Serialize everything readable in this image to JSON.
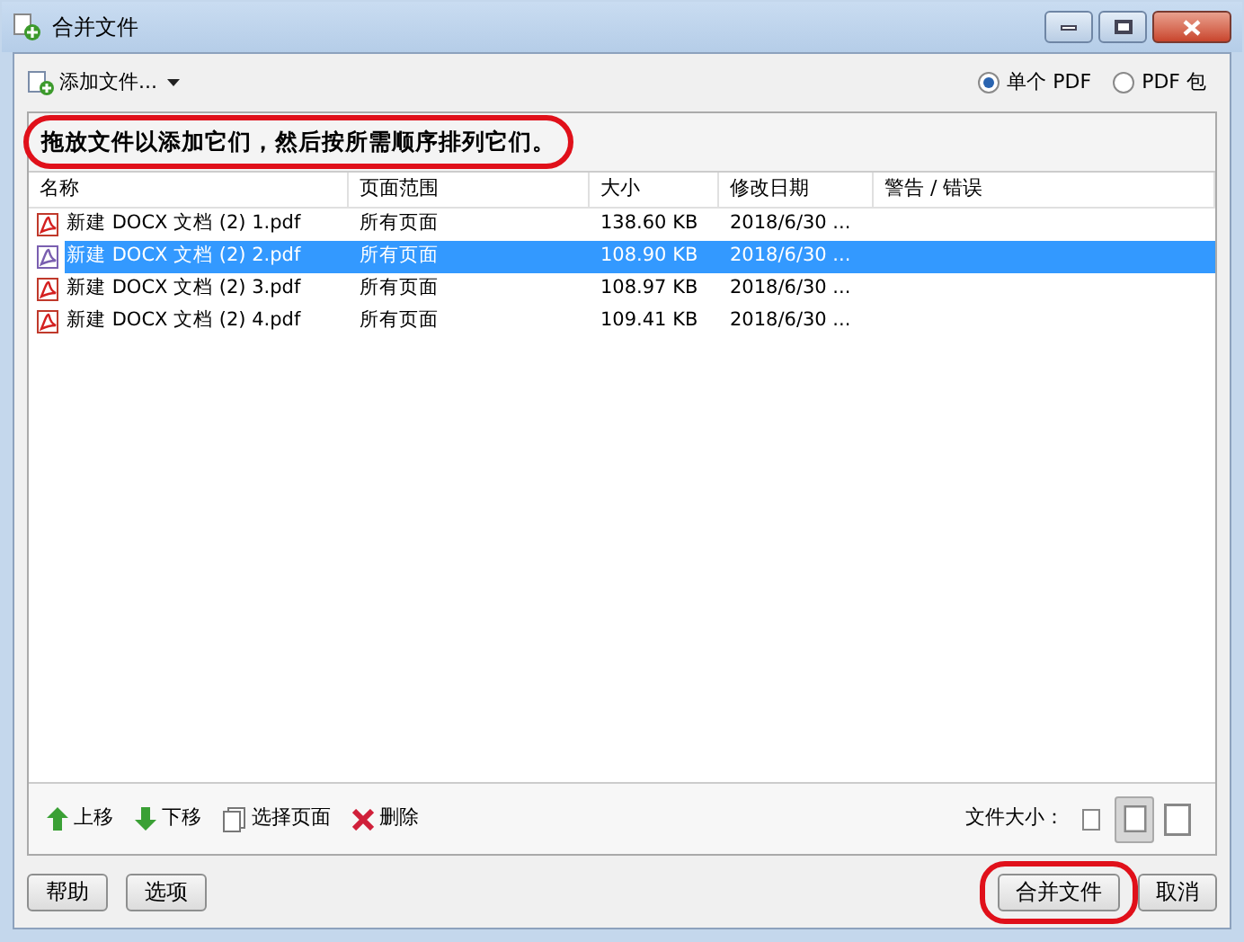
{
  "window": {
    "title": "合并文件"
  },
  "toolbar": {
    "add_button": "添加文件..."
  },
  "output_mode": [
    {
      "label": "单个 PDF",
      "selected": true
    },
    {
      "label": "PDF 包",
      "selected": false
    }
  ],
  "instruction": {
    "text": "拖放文件以添加它们，然后按所需顺序排列它们。",
    "highlighted": true
  },
  "table": {
    "columns": [
      "名称",
      "页面范围",
      "大小",
      "修改日期",
      "警告 / 错误"
    ],
    "rows": [
      {
        "cells": [
          "新建 DOCX 文档 (2) 1.pdf",
          "所有页面",
          "138.60 KB",
          "2018/6/30 ..."
        ],
        "selected": false
      },
      {
        "cells": [
          "新建 DOCX 文档 (2) 2.pdf",
          "所有页面",
          "108.90 KB",
          "2018/6/30 ..."
        ],
        "selected": true
      },
      {
        "cells": [
          "新建 DOCX 文档 (2) 3.pdf",
          "所有页面",
          "108.97 KB",
          "2018/6/30 ..."
        ],
        "selected": false
      },
      {
        "cells": [
          "新建 DOCX 文档 (2) 4.pdf",
          "所有页面",
          "109.41 KB",
          "2018/6/30 ..."
        ],
        "selected": false
      }
    ]
  },
  "actions": [
    {
      "kind": "up",
      "label": "上移"
    },
    {
      "kind": "down",
      "label": "下移"
    },
    {
      "kind": "pages",
      "label": "选择页面"
    },
    {
      "kind": "delete",
      "label": "删除"
    }
  ],
  "file_size": {
    "label": "文件大小：",
    "options": [
      {
        "selected": false
      },
      {
        "selected": true
      },
      {
        "selected": false
      }
    ]
  },
  "left_buttons": [
    {
      "label": "帮助"
    },
    {
      "label": "选项"
    }
  ],
  "right_buttons": [
    {
      "label": "合并文件",
      "highlighted": true
    },
    {
      "label": "取消",
      "highlighted": false
    }
  ]
}
